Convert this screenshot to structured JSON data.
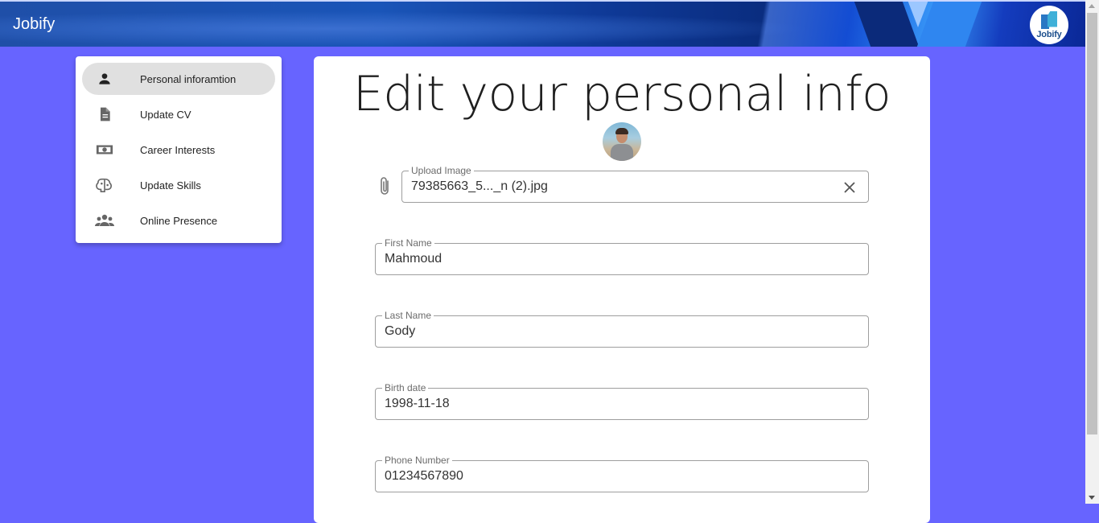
{
  "header": {
    "title": "Jobify",
    "logo_text": "Jobify"
  },
  "sidebar": {
    "items": [
      {
        "label": "Personal inforamtion",
        "icon": "person-icon",
        "active": true
      },
      {
        "label": "Update CV",
        "icon": "document-icon",
        "active": false
      },
      {
        "label": "Career Interests",
        "icon": "money-icon",
        "active": false
      },
      {
        "label": "Update Skills",
        "icon": "brain-icon",
        "active": false
      },
      {
        "label": "Online Presence",
        "icon": "group-icon",
        "active": false
      }
    ]
  },
  "main": {
    "title": "Edit your personal info",
    "upload": {
      "label": "Upload Image",
      "value": "79385663_5..._n (2).jpg"
    },
    "first_name": {
      "label": "First Name",
      "value": "Mahmoud"
    },
    "last_name": {
      "label": "Last Name",
      "value": "Gody"
    },
    "birth_date": {
      "label": "Birth date",
      "value": "1998-11-18"
    },
    "phone": {
      "label": "Phone Number",
      "value": "01234567890"
    }
  },
  "colors": {
    "background": "#6764ff",
    "appbar": "#1a4fae",
    "active_item": "#e0e0e0"
  }
}
